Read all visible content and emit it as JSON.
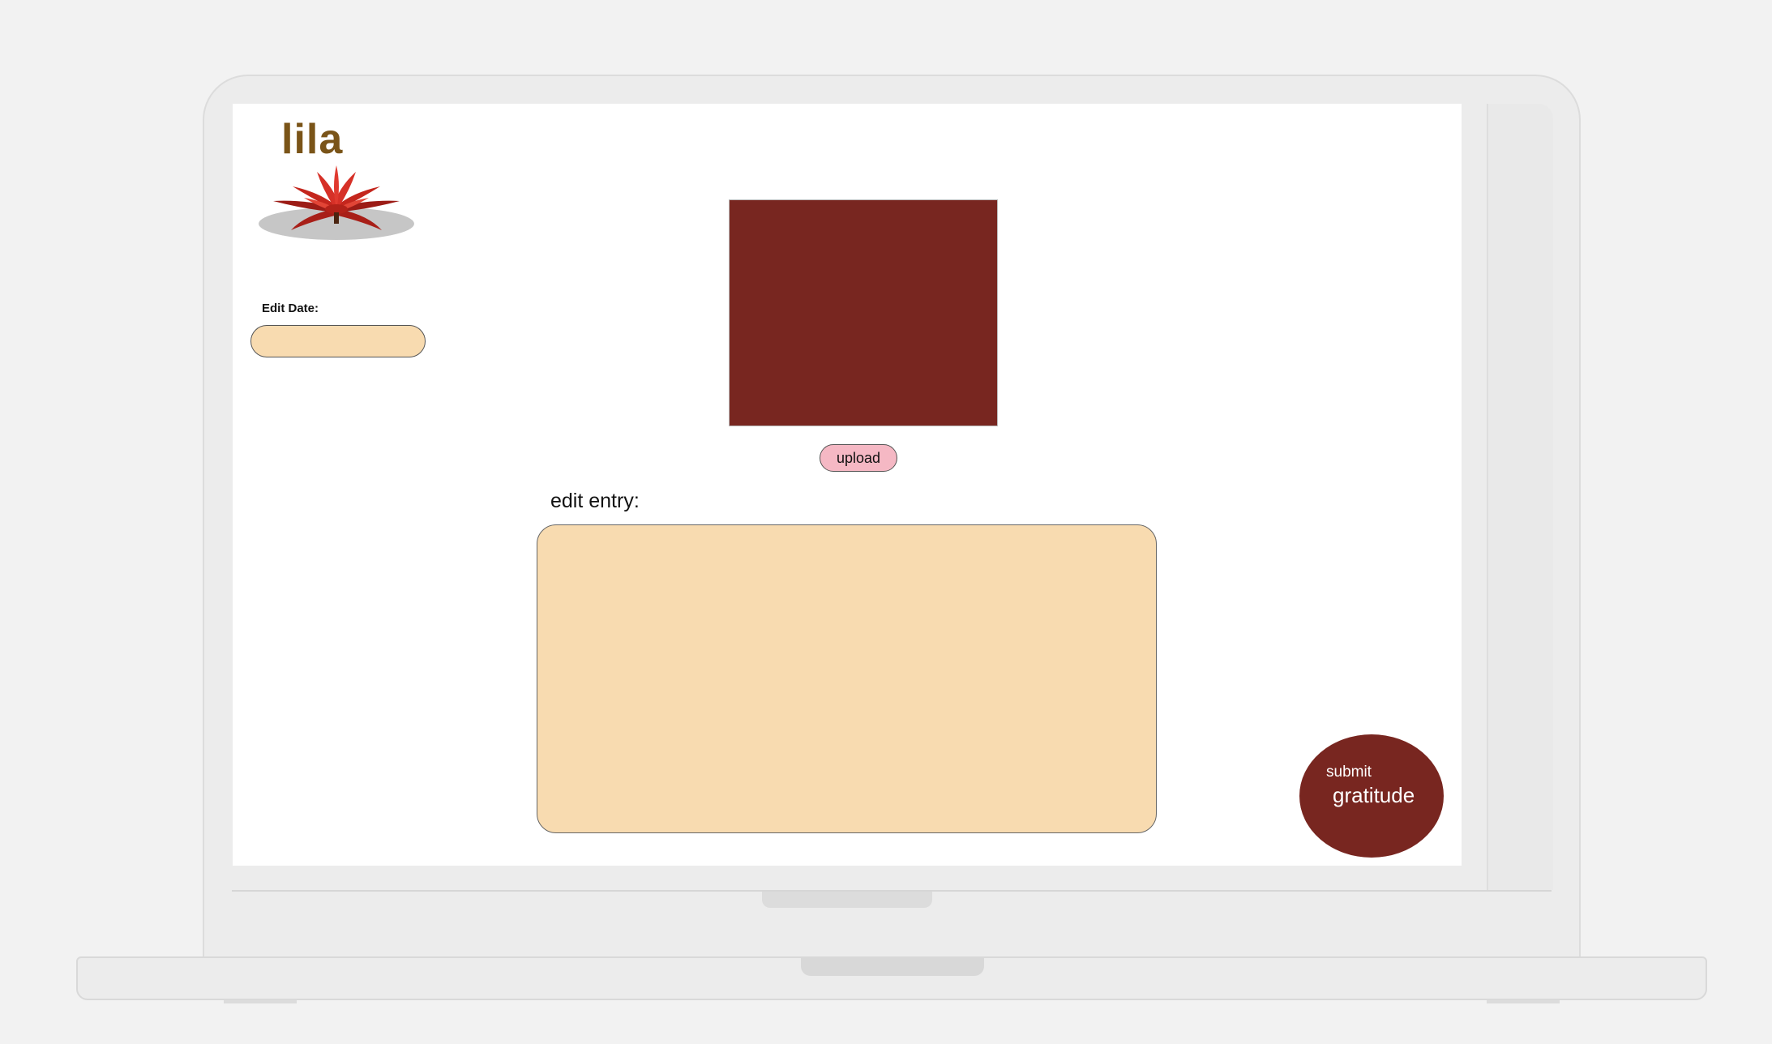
{
  "app": {
    "logo_text": "lila"
  },
  "sidebar": {
    "date_label": "Edit Date:",
    "date_value": "",
    "date_placeholder": ""
  },
  "main": {
    "upload_label": "upload",
    "entry_label": "edit entry:",
    "entry_value": "",
    "submit_line1": "submit",
    "submit_line2": "gratitude"
  },
  "colors": {
    "brand_dark_red": "#782620",
    "input_peach": "#f8dbb0",
    "upload_pink": "#f5b8c4",
    "logo_brown": "#7a5418"
  },
  "icons": {
    "logo": "lotus-flower-icon"
  }
}
